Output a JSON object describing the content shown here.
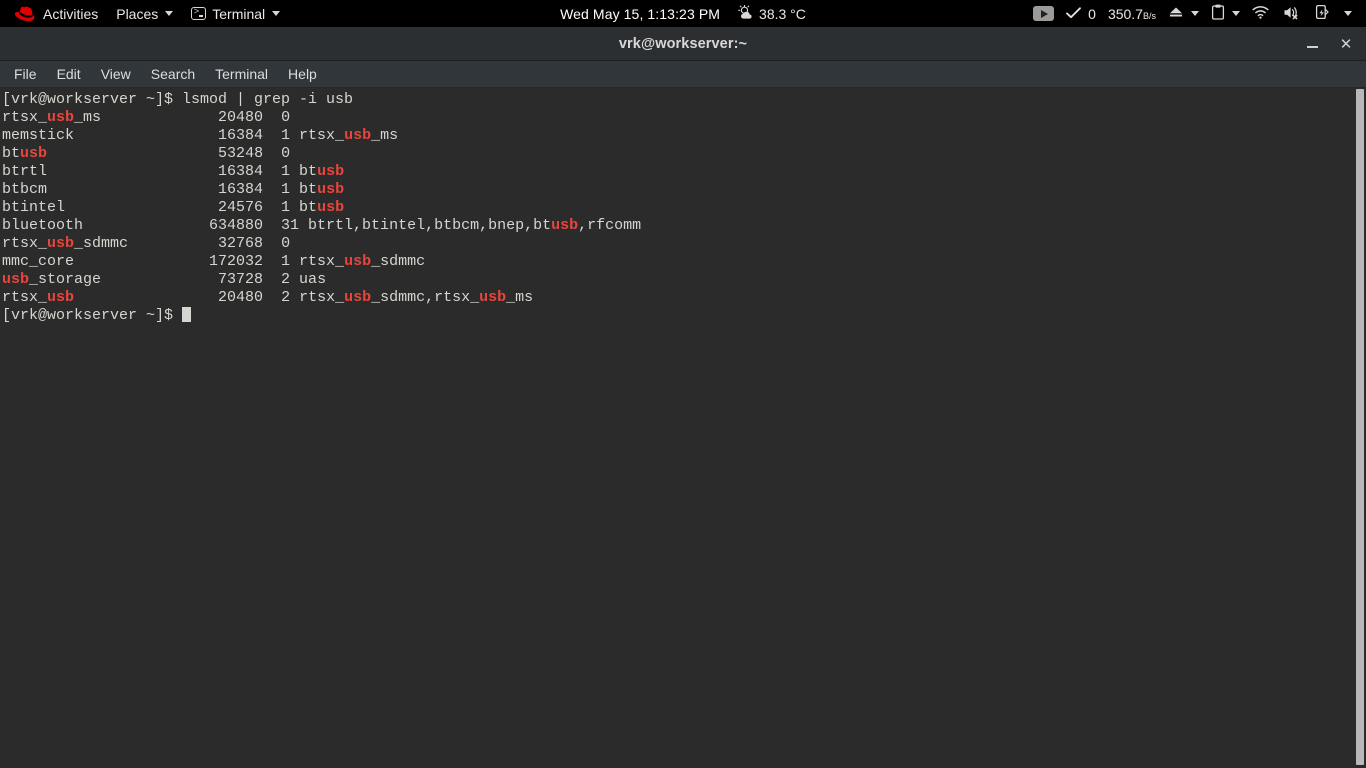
{
  "panel": {
    "activities_label": "Activities",
    "places_label": "Places",
    "terminal_label": "Terminal",
    "clock": "Wed May 15,  1:13:23 PM",
    "temperature": "38.3 °C",
    "check_count": "0",
    "network_speed_value": "350.7",
    "network_speed_unit": "B/s",
    "icons": {
      "redhat": "redhat-logo-icon",
      "terminal_app": "terminal-app-icon",
      "weather": "weather-sun-cloud-icon",
      "media": "media-play-icon",
      "check": "checkmark-icon",
      "eject": "eject-icon",
      "clipboard": "clipboard-icon",
      "wifi": "wifi-icon",
      "volume": "volume-muted-icon",
      "battery": "battery-charging-icon"
    },
    "colors": {
      "panel_bg": "#000000",
      "logo_red": "#e00000",
      "text": "#e8e8e8"
    }
  },
  "window": {
    "title": "vrk@workserver:~",
    "minimize_label": "–",
    "close_label": "✕",
    "menu": [
      {
        "label": "File"
      },
      {
        "label": "Edit"
      },
      {
        "label": "View"
      },
      {
        "label": "Search"
      },
      {
        "label": "Terminal"
      },
      {
        "label": "Help"
      }
    ]
  },
  "terminal": {
    "colors": {
      "background": "#2b2b2b",
      "foreground": "#d3d7cf",
      "highlight": "#e8453c"
    },
    "prompt": "[vrk@workserver ~]$ ",
    "command": "lsmod | grep -i usb",
    "match": "usb",
    "columns": {
      "name_width": 21,
      "size_width": 8
    },
    "rows": [
      {
        "module": "rtsx_usb_ms",
        "size": "20480",
        "used_by_count": "0",
        "used_by": ""
      },
      {
        "module": "memstick",
        "size": "16384",
        "used_by_count": "1",
        "used_by": "rtsx_usb_ms"
      },
      {
        "module": "btusb",
        "size": "53248",
        "used_by_count": "0",
        "used_by": ""
      },
      {
        "module": "btrtl",
        "size": "16384",
        "used_by_count": "1",
        "used_by": "btusb"
      },
      {
        "module": "btbcm",
        "size": "16384",
        "used_by_count": "1",
        "used_by": "btusb"
      },
      {
        "module": "btintel",
        "size": "24576",
        "used_by_count": "1",
        "used_by": "btusb"
      },
      {
        "module": "bluetooth",
        "size": "634880",
        "used_by_count": "31",
        "used_by": "btrtl,btintel,btbcm,bnep,btusb,rfcomm"
      },
      {
        "module": "rtsx_usb_sdmmc",
        "size": "32768",
        "used_by_count": "0",
        "used_by": ""
      },
      {
        "module": "mmc_core",
        "size": "172032",
        "used_by_count": "1",
        "used_by": "rtsx_usb_sdmmc"
      },
      {
        "module": "usb_storage",
        "size": "73728",
        "used_by_count": "2",
        "used_by": "uas"
      },
      {
        "module": "rtsx_usb",
        "size": "20480",
        "used_by_count": "2",
        "used_by": "rtsx_usb_sdmmc,rtsx_usb_ms"
      }
    ],
    "final_prompt": "[vrk@workserver ~]$ ",
    "cursor_visible": true
  }
}
